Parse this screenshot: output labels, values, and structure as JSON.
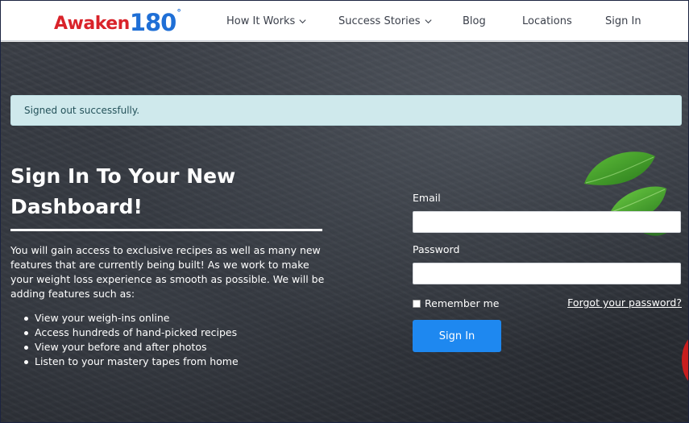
{
  "brand": {
    "logo_word": "Awaken",
    "logo_number": "180",
    "logo_degree": "°",
    "colors": {
      "word": "#d9232a",
      "number": "#1f6fd6"
    }
  },
  "nav": {
    "how_it_works": "How It Works",
    "success_stories": "Success Stories",
    "blog": "Blog",
    "locations": "Locations",
    "sign_in": "Sign In"
  },
  "alert": {
    "message": "Signed out successfully."
  },
  "hero": {
    "title": "Sign In To Your New Dashboard!",
    "description": "You will gain access to exclusive recipes as well as many new features that are currently being built! As we work to make your weight loss experience as smooth as possible. We will be adding features such as:",
    "features": [
      "View your weigh-ins online",
      "Access hundreds of hand-picked recipes",
      "View your before and after photos",
      "Listen to your mastery tapes from home"
    ]
  },
  "form": {
    "email_label": "Email",
    "email_value": "",
    "password_label": "Password",
    "password_value": "",
    "remember_label": "Remember me",
    "remember_checked": false,
    "forgot_link": "Forgot your password?",
    "submit_label": "Sign In",
    "accent_color": "#1e88f0"
  },
  "icons": {
    "nav_dropdown": "chevron-down-icon",
    "decor_leaves": "basil-leaves-icon",
    "decor_tomato": "tomato-icon"
  }
}
